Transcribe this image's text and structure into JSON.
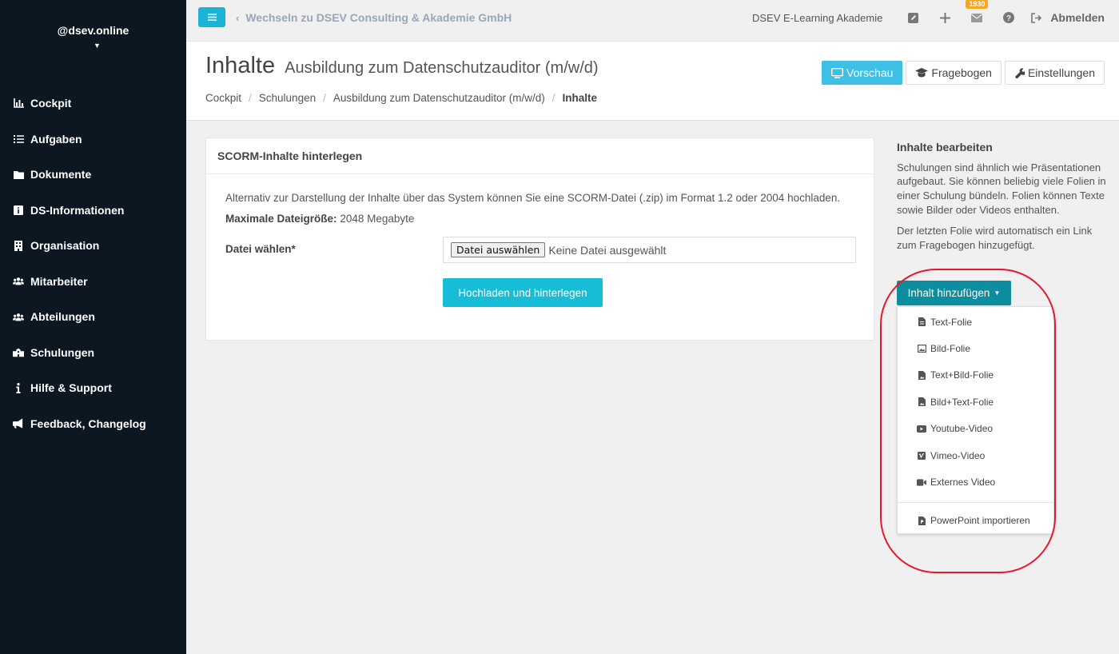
{
  "sidebar": {
    "brand": "@dsev.online",
    "items": [
      {
        "label": "Cockpit",
        "icon": "chart-icon"
      },
      {
        "label": "Aufgaben",
        "icon": "tasks-icon"
      },
      {
        "label": "Dokumente",
        "icon": "folder-icon"
      },
      {
        "label": "DS-Informationen",
        "icon": "info-square-icon"
      },
      {
        "label": "Organisation",
        "icon": "building-icon"
      },
      {
        "label": "Mitarbeiter",
        "icon": "users-icon"
      },
      {
        "label": "Abteilungen",
        "icon": "users-icon"
      },
      {
        "label": "Schulungen",
        "icon": "school-icon"
      },
      {
        "label": "Hilfe & Support",
        "icon": "info-icon"
      },
      {
        "label": "Feedback, Changelog",
        "icon": "megaphone-icon"
      }
    ]
  },
  "topbar": {
    "switch_label": "Wechseln zu DSEV Consulting & Akademie GmbH",
    "org_name": "DSEV E-Learning Akademie",
    "mail_badge": "1930",
    "logout_label": "Abmelden"
  },
  "header": {
    "title": "Inhalte",
    "subtitle": "Ausbildung zum Datenschutzauditor (m/w/d)",
    "breadcrumb": [
      "Cockpit",
      "Schulungen",
      "Ausbildung zum Datenschutzauditor (m/w/d)",
      "Inhalte"
    ],
    "buttons": {
      "preview": "Vorschau",
      "questionnaire": "Fragebogen",
      "settings": "Einstellungen"
    }
  },
  "panel": {
    "title": "SCORM-Inhalte hinterlegen",
    "description": "Alternativ zur Darstellung der Inhalte über das System können Sie eine SCORM-Datei (.zip) im Format 1.2 oder 2004 hochladen.",
    "max_size_label": "Maximale Dateigröße:",
    "max_size_value": "2048 Megabyte",
    "file_label": "Datei wählen*",
    "file_button": "Datei auswählen",
    "file_status": "Keine Datei ausgewählt",
    "upload_button": "Hochladen und hinterlegen"
  },
  "right": {
    "heading": "Inhalte bearbeiten",
    "text1": "Schulungen sind ähnlich wie Präsentationen aufgebaut. Sie können beliebig viele Folien in einer Schulung bündeln. Folien können Texte sowie Bilder oder Videos enthalten.",
    "text2": "Der letzten Folie wird automatisch ein Link zum Fragebogen hinzugefügt.",
    "add_button": "Inhalt hinzufügen",
    "menu": [
      {
        "label": "Text-Folie",
        "icon": "file-text-icon"
      },
      {
        "label": "Bild-Folie",
        "icon": "image-icon"
      },
      {
        "label": "Text+Bild-Folie",
        "icon": "file-image-icon"
      },
      {
        "label": "Bild+Text-Folie",
        "icon": "file-image-icon"
      },
      {
        "label": "Youtube-Video",
        "icon": "youtube-icon"
      },
      {
        "label": "Vimeo-Video",
        "icon": "vimeo-icon"
      },
      {
        "label": "Externes Video",
        "icon": "video-camera-icon"
      }
    ],
    "menu_import": {
      "label": "PowerPoint importieren",
      "icon": "powerpoint-file-icon"
    }
  },
  "colors": {
    "sidebar_bg": "#0c1722",
    "accent": "#17bcd7",
    "add_button": "#0c8ea0",
    "highlight_ring": "#e3192e",
    "badge": "#f5a623"
  }
}
